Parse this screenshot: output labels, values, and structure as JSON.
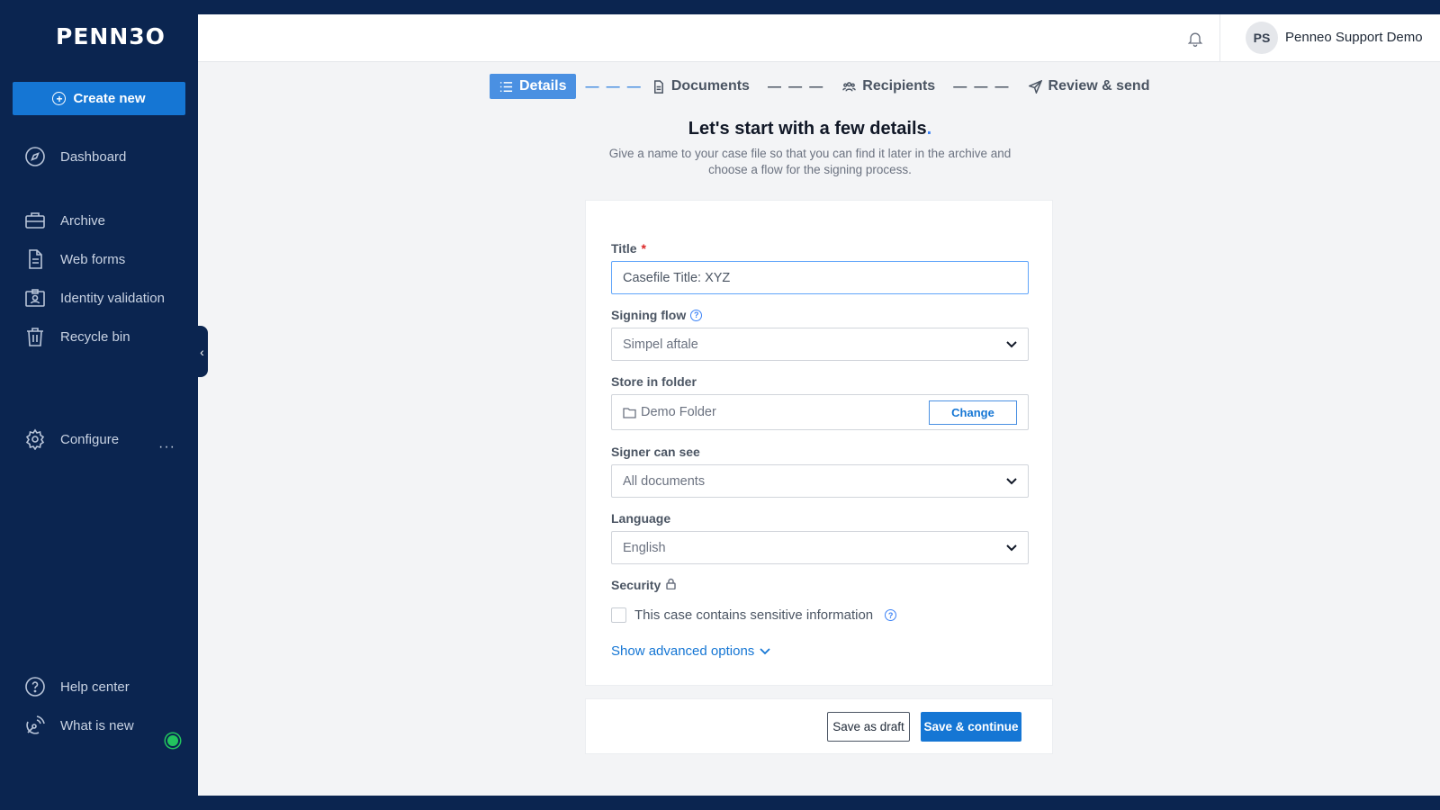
{
  "app": {
    "logo_text": "PENN3O",
    "create_new_label": "Create new"
  },
  "sidebar": {
    "items": [
      {
        "label": "Dashboard",
        "icon": "compass-icon"
      },
      {
        "label": "Archive",
        "icon": "briefcase-icon"
      },
      {
        "label": "Web forms",
        "icon": "document-icon"
      },
      {
        "label": "Identity validation",
        "icon": "id-badge-icon"
      },
      {
        "label": "Recycle bin",
        "icon": "trash-icon"
      },
      {
        "label": "Configure",
        "icon": "gear-icon"
      },
      {
        "label": "Help center",
        "icon": "help-icon"
      },
      {
        "label": "What is new",
        "icon": "broadcast-icon"
      }
    ],
    "configure_more": "···"
  },
  "header": {
    "user_initials": "PS",
    "user_name": "Penneo Support Demo"
  },
  "stepper": {
    "steps": [
      {
        "label": "Details",
        "active": true
      },
      {
        "label": "Documents",
        "active": false
      },
      {
        "label": "Recipients",
        "active": false
      },
      {
        "label": "Review & send",
        "active": false
      }
    ],
    "separator": "— — —"
  },
  "page": {
    "heading": "Let's start with a few details",
    "heading_dot": ".",
    "subtext": "Give a name to your case file so that you can find it later in the archive and choose a flow for the signing process."
  },
  "form": {
    "title_label": "Title",
    "title_required": "*",
    "title_value": "Casefile Title: XYZ",
    "signing_flow_label": "Signing flow",
    "signing_flow_value": "Simpel aftale",
    "folder_label": "Store in folder",
    "folder_value": "Demo Folder",
    "change_label": "Change",
    "signer_label": "Signer can see",
    "signer_value": "All documents",
    "language_label": "Language",
    "language_value": "English",
    "security_label": "Security",
    "sensitive_label": "This case contains sensitive information",
    "sensitive_checked": false,
    "advanced_label": "Show advanced options"
  },
  "footer": {
    "draft_label": "Save as draft",
    "continue_label": "Save & continue"
  },
  "colors": {
    "sidebar_bg": "#0b2550",
    "primary": "#1576d4",
    "active_step": "#4a90e2",
    "status_green": "#22c55e"
  }
}
